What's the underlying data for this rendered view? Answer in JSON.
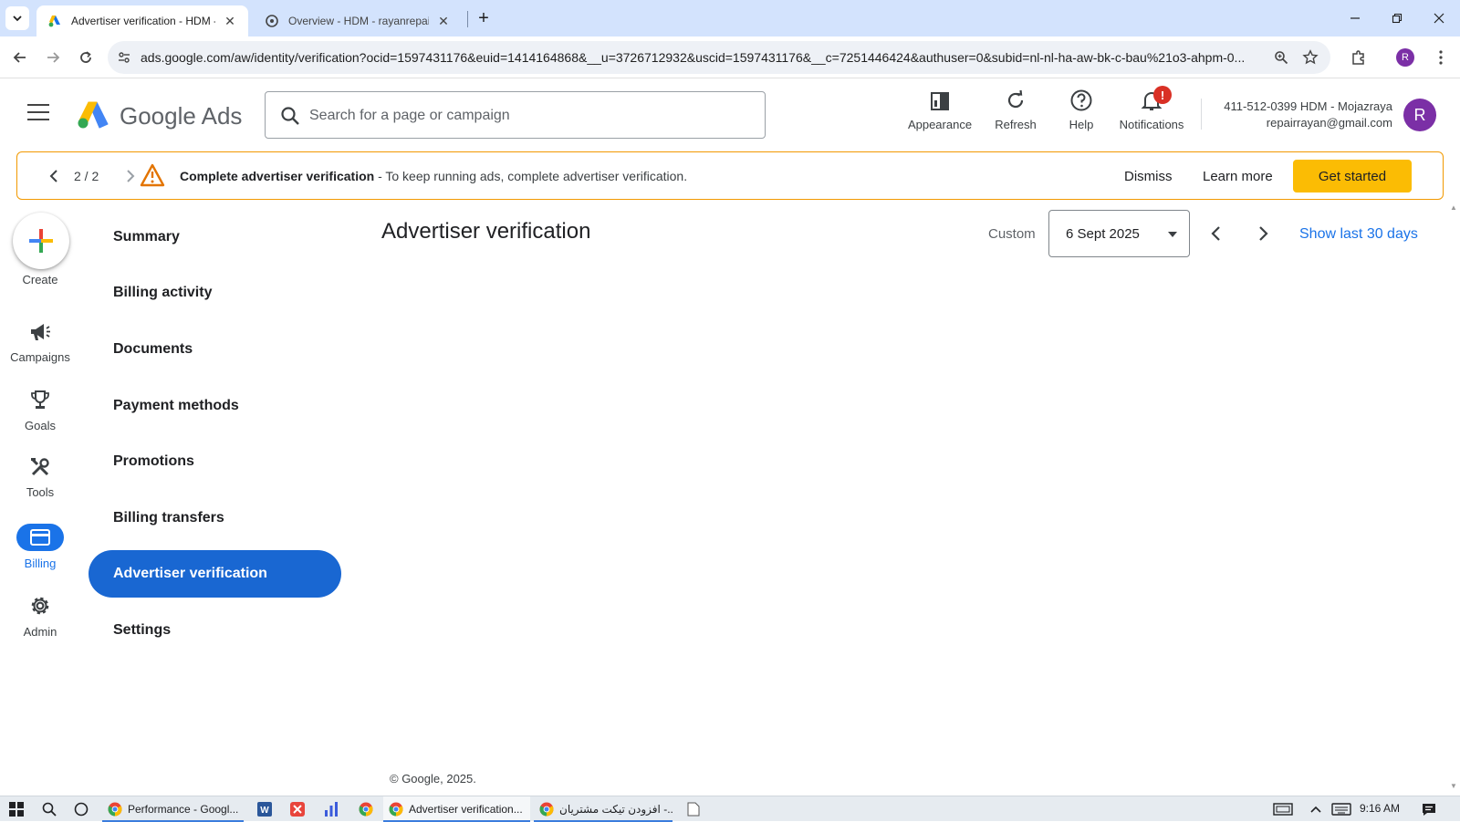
{
  "browser": {
    "tabs": [
      {
        "title": "Advertiser verification - HDM -",
        "active": true
      },
      {
        "title": "Overview - HDM - rayanrepair",
        "active": false
      }
    ],
    "url": "ads.google.com/aw/identity/verification?ocid=1597431176&euid=1414164868&__u=3726712932&uscid=1597431176&__c=7251446424&authuser=0&subid=nl-nl-ha-aw-bk-c-bau%21o3-ahpm-0...",
    "profile_initial": "R"
  },
  "header": {
    "brand": "Google Ads",
    "search_placeholder": "Search for a page or campaign",
    "actions": {
      "appearance": "Appearance",
      "refresh": "Refresh",
      "help": "Help",
      "notifications": "Notifications"
    },
    "notification_badge": "!",
    "account_line1": "411-512-0399 HDM - Mojazraya",
    "account_line2": "repairrayan@gmail.com",
    "avatar_initial": "R"
  },
  "banner": {
    "count": "2 / 2",
    "title": "Complete advertiser verification",
    "message": " - To keep running ads, complete advertiser verification.",
    "dismiss": "Dismiss",
    "learn_more": "Learn more",
    "get_started": "Get started"
  },
  "rail": {
    "create": "Create",
    "campaigns": "Campaigns",
    "goals": "Goals",
    "tools": "Tools",
    "billing": "Billing",
    "admin": "Admin"
  },
  "subnav": {
    "items": [
      "Summary",
      "Billing activity",
      "Documents",
      "Payment methods",
      "Promotions",
      "Billing transfers",
      "Advertiser verification",
      "Settings"
    ],
    "active_index": 6
  },
  "main": {
    "title": "Advertiser verification",
    "date_label": "Custom",
    "date_value": "6 Sept 2025",
    "show_last": "Show last 30 days",
    "copyright": "© Google, 2025."
  },
  "taskbar": {
    "apps": [
      {
        "title": "Performance - Googl..."
      },
      {
        "title": "Advertiser verification..."
      },
      {
        "title": "افزودن تیکت مشتریان -..."
      }
    ],
    "clock": "9:16 AM"
  },
  "colors": {
    "accent_blue": "#1a73e8",
    "active_nav": "#1967d2",
    "warning": "#f29900",
    "cta_yellow": "#fbbc04",
    "badge_red": "#d93025",
    "avatar_purple": "#7b2fa6"
  }
}
